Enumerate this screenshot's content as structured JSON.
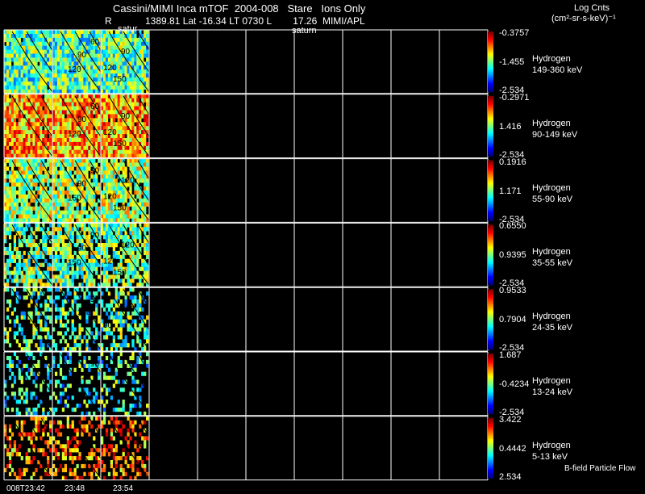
{
  "header": {
    "title": "Cassini/MIMI Inca mTOF  2004-008   Stare   Ions Only",
    "r_label": "R",
    "position_info": "1389.81 Lat -16.34 LT 0730 L        17.26  MIMI/APL",
    "corner_label_1": "satur",
    "corner_label_2": "saturn",
    "units_title": "Log Cnts",
    "units": "(cm²-sr-s-keV)⁻¹"
  },
  "panels": [
    {
      "species": "Hydrogen",
      "energy": "149-360 keV",
      "cmax": "-0.3757",
      "cmid": "-1.455",
      "cmin": "-2.534",
      "contours": [
        "60",
        "90",
        "90",
        "120",
        "120",
        "150"
      ],
      "fill": 0.98,
      "warm": 0.45
    },
    {
      "species": "Hydrogen",
      "energy": "90-149 keV",
      "cmax": "-0.2971",
      "cmid": "1.416",
      "cmin": "-2.534",
      "contours": [
        "60",
        "90",
        "90",
        "120",
        "120",
        "150"
      ],
      "fill": 0.98,
      "warm": 0.7
    },
    {
      "species": "Hydrogen",
      "energy": "55-90 keV",
      "cmax": "0.1916",
      "cmid": "1.171",
      "cmin": "-2.534",
      "contours": [
        "90",
        "90",
        "120",
        "120",
        "150",
        "150"
      ],
      "fill": 0.9,
      "warm": 0.55
    },
    {
      "species": "Hydrogen",
      "energy": "35-55 keV",
      "cmax": "0.6550",
      "cmid": "0.9395",
      "cmin": "-2.534",
      "contours": [
        "90",
        "90",
        "120",
        "120",
        "150",
        "150"
      ],
      "fill": 0.75,
      "warm": 0.5
    },
    {
      "species": "Hydrogen",
      "energy": "24-35 keV",
      "cmax": "0.9533",
      "cmid": "0.7904",
      "cmin": "-2.534",
      "contours": [
        "90",
        "120",
        "120",
        "90"
      ],
      "fill": 0.45,
      "warm": 0.45
    },
    {
      "species": "Hydrogen",
      "energy": "13-24 keV",
      "cmax": "1.687",
      "cmid": "-0.4234",
      "cmin": "-2.534",
      "contours": [
        "90",
        "120"
      ],
      "fill": 0.3,
      "warm": 0.4
    },
    {
      "species": "Hydrogen",
      "energy": "5-13 keV",
      "cmax": "3.422",
      "cmid": "0.4442",
      "cmin": "2.534",
      "contours": [],
      "fill": 0.35,
      "warm": 0.75
    }
  ],
  "time_labels": [
    "008T23:42",
    "23:48",
    "23:54"
  ],
  "footer_note": "B-field Particle Flow"
}
